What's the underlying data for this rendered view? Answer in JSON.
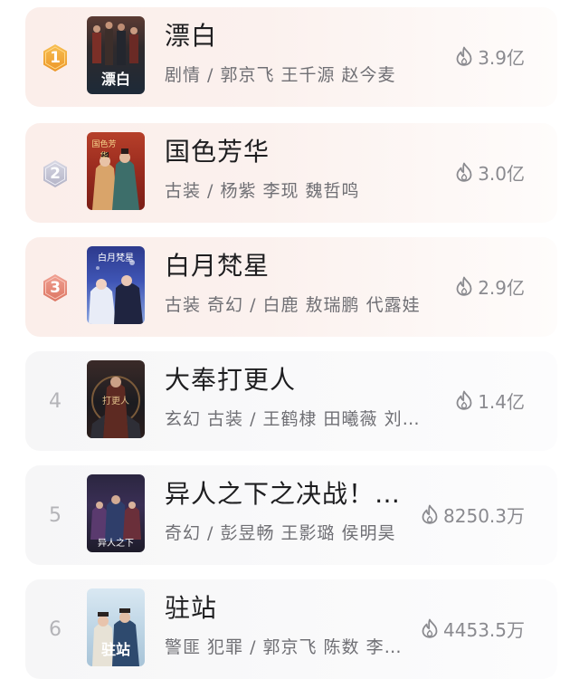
{
  "ranking": {
    "items": [
      {
        "rank": "1",
        "title": "漂白",
        "meta": "剧情 / 郭京飞 王千源 赵今麦",
        "heat": "3.9亿",
        "poster_caption": "漂白"
      },
      {
        "rank": "2",
        "title": "国色芳华",
        "meta": "古装 / 杨紫 李现 魏哲鸣",
        "heat": "3.0亿",
        "poster_caption": "国色芳华"
      },
      {
        "rank": "3",
        "title": "白月梵星",
        "meta": "古装 奇幻 / 白鹿 敖瑞鹏 代露娃",
        "heat": "2.9亿",
        "poster_caption": "白月梵星"
      },
      {
        "rank": "4",
        "title": "大奉打更人",
        "meta": "玄幻 古装 / 王鹤棣 田曦薇 刘…",
        "heat": "1.4亿",
        "poster_caption": "打更人"
      },
      {
        "rank": "5",
        "title": "异人之下之决战！…",
        "meta": "奇幻 / 彭昱畅 王影璐 侯明昊",
        "heat": "8250.3万",
        "poster_caption": "异人之下"
      },
      {
        "rank": "6",
        "title": "驻站",
        "meta": "警匪 犯罪 / 郭京飞 陈数 李…",
        "heat": "4453.5万",
        "poster_caption": "驻站"
      }
    ]
  },
  "icons": {
    "rank_badge": "hexagon-medal-icon",
    "heat": "flame-icon"
  },
  "colors": {
    "gold": "#f2a63b",
    "silver": "#c3c3d3",
    "bronze": "#e4887a",
    "rank_plain": "#b4b4b8",
    "title": "#1e1e20",
    "meta": "#6f6f74",
    "heat": "#8a8a8f"
  }
}
